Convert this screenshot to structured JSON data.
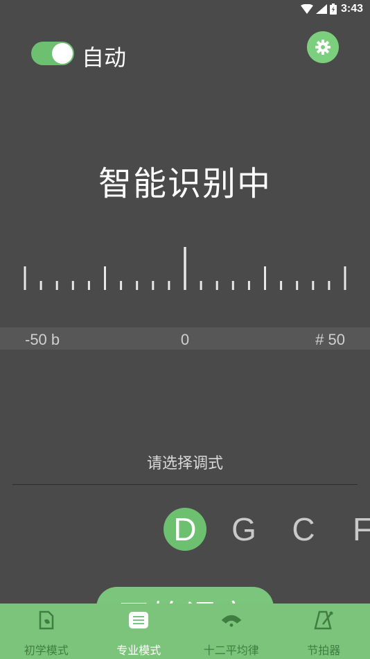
{
  "status_bar": {
    "time": "3:43"
  },
  "auto_toggle": {
    "label": "自动",
    "on": true
  },
  "settings": {
    "icon": "gear-icon"
  },
  "tuning_status": "智能识别中",
  "scale": {
    "left": "-50 b",
    "center": "0",
    "right": "# 50"
  },
  "mode_hint": "请选择调式",
  "notes": [
    "D",
    "G",
    "C",
    "F"
  ],
  "selected_note": "D",
  "start_button": {
    "label": "开始调音"
  },
  "bottom_nav": [
    {
      "label": "初学模式",
      "icon": "beginner-icon",
      "active": false
    },
    {
      "label": "专业模式",
      "icon": "pro-mode-icon",
      "active": true
    },
    {
      "label": "十二平均律",
      "icon": "temperament-icon",
      "active": false
    },
    {
      "label": "节拍器",
      "icon": "metronome-icon",
      "active": false
    }
  ],
  "colors": {
    "background": "#4a4a4a",
    "accent": "#6cc070",
    "nav_bg": "#7cc47c",
    "nav_inactive": "#3f7d41"
  }
}
